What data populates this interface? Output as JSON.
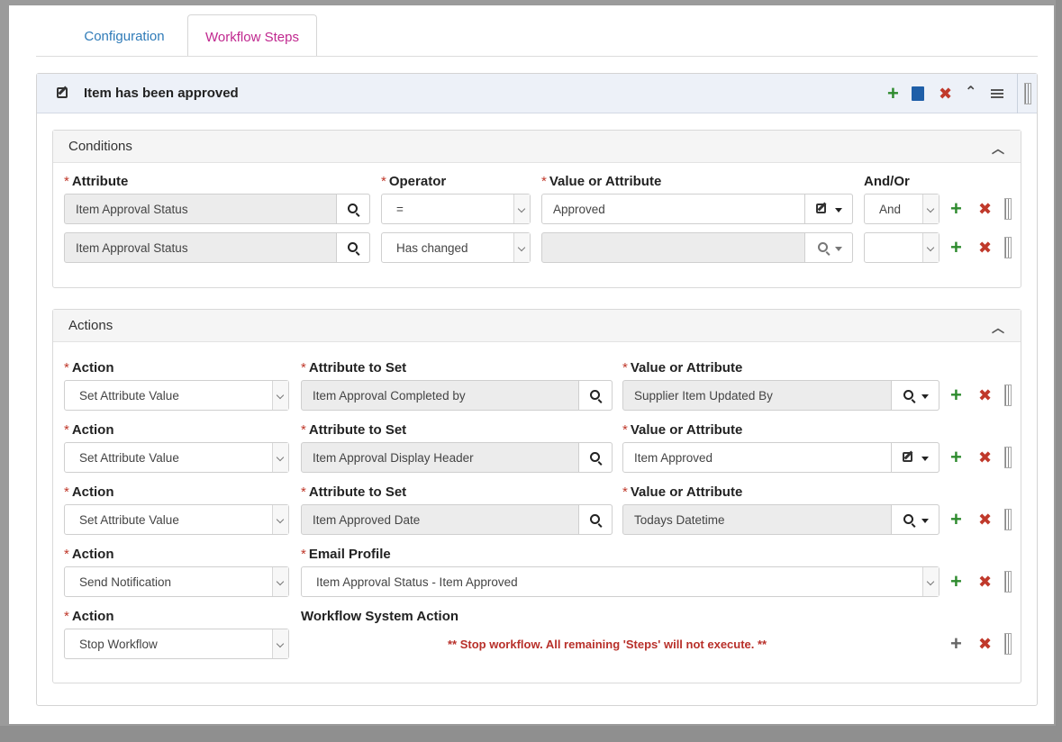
{
  "tabs": [
    {
      "label": "Configuration"
    },
    {
      "label": "Workflow Steps"
    }
  ],
  "step": {
    "title": "Item has been approved",
    "toolbar_icons": [
      "plus-icon",
      "copy-icon",
      "close-icon",
      "chevron-up-icon",
      "menu-icon"
    ]
  },
  "conditions": {
    "title": "Conditions",
    "headers": {
      "attribute": "Attribute",
      "operator": "Operator",
      "value": "Value or Attribute",
      "andor": "And/Or"
    },
    "rows": [
      {
        "attribute": "Item Approval Status",
        "operator": "=",
        "value": "Approved",
        "andor": "And"
      },
      {
        "attribute": "Item Approval Status",
        "operator": "Has changed",
        "value": "",
        "andor": ""
      }
    ]
  },
  "actions": {
    "title": "Actions",
    "labels": {
      "action": "Action",
      "attribute_to_set": "Attribute to Set",
      "value": "Value or Attribute",
      "email_profile": "Email Profile",
      "system_action": "Workflow System Action"
    },
    "rows": [
      {
        "action": "Set Attribute Value",
        "attribute": "Item Approval Completed by",
        "value": "Supplier Item Updated By"
      },
      {
        "action": "Set Attribute Value",
        "attribute": "Item Approval Display Header",
        "value": "Item Approved"
      },
      {
        "action": "Set Attribute Value",
        "attribute": "Item Approved Date",
        "value": "Todays Datetime"
      }
    ],
    "email_row": {
      "action": "Send Notification",
      "email_profile": "Item Approval Status - Item Approved"
    },
    "stop_row": {
      "action": "Stop Workflow",
      "message": "** Stop workflow. All remaining 'Steps' will not execute. **"
    }
  },
  "colors": {
    "accent_tab": "#c0288f",
    "link": "#2f7bb8",
    "add": "#2e8b2e",
    "remove": "#c0392b",
    "required": "#c0392b"
  }
}
